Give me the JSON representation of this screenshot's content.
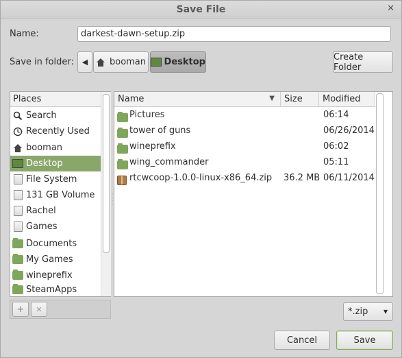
{
  "window": {
    "title": "Save File",
    "close_glyph": "✕"
  },
  "name": {
    "label": "Name:",
    "value": "darkest-dawn-setup.zip"
  },
  "folder": {
    "label": "Save in folder:",
    "back_glyph": "◀",
    "crumbs": [
      {
        "label": "booman",
        "icon": "home-icon"
      },
      {
        "label": "Desktop",
        "icon": "desktop-icon",
        "active": true
      }
    ],
    "create_folder_label": "Create Folder"
  },
  "places": {
    "header": "Places",
    "items": [
      {
        "label": "Search",
        "icon": "search-icon"
      },
      {
        "label": "Recently Used",
        "icon": "recent-icon"
      },
      {
        "label": "booman",
        "icon": "home-icon"
      },
      {
        "label": "Desktop",
        "icon": "desktop-icon",
        "selected": true
      },
      {
        "label": "File System",
        "icon": "drive-icon"
      },
      {
        "label": "131 GB Volume",
        "icon": "drive-icon"
      },
      {
        "label": "Rachel",
        "icon": "drive-icon"
      },
      {
        "label": "Games",
        "icon": "drive-icon"
      },
      {
        "label": "Documents",
        "icon": "folder-icon"
      },
      {
        "label": "My Games",
        "icon": "folder-icon"
      },
      {
        "label": "wineprefix",
        "icon": "folder-icon"
      },
      {
        "label": "SteamApps",
        "icon": "folder-icon"
      }
    ],
    "add_glyph": "+",
    "remove_glyph": "✕"
  },
  "files": {
    "columns": {
      "name": "Name",
      "size": "Size",
      "modified": "Modified",
      "sort_glyph": "▼"
    },
    "rows": [
      {
        "name": "Pictures",
        "size": "",
        "modified": "06:14",
        "icon": "folder-icon"
      },
      {
        "name": "tower of guns",
        "size": "",
        "modified": "06/26/2014",
        "icon": "folder-icon"
      },
      {
        "name": "wineprefix",
        "size": "",
        "modified": "06:02",
        "icon": "folder-icon"
      },
      {
        "name": "wing_commander",
        "size": "",
        "modified": "05:11",
        "icon": "folder-icon"
      },
      {
        "name": "rtcwcoop-1.0.0-linux-x86_64.zip",
        "size": "36.2 MB",
        "modified": "06/11/2014",
        "icon": "package-icon"
      }
    ]
  },
  "filter": {
    "value": "*.zip",
    "glyph": "▾"
  },
  "actions": {
    "cancel": "Cancel",
    "save": "Save"
  },
  "colors": {
    "accent": "#8aa76a",
    "folder": "#7fa65a"
  }
}
